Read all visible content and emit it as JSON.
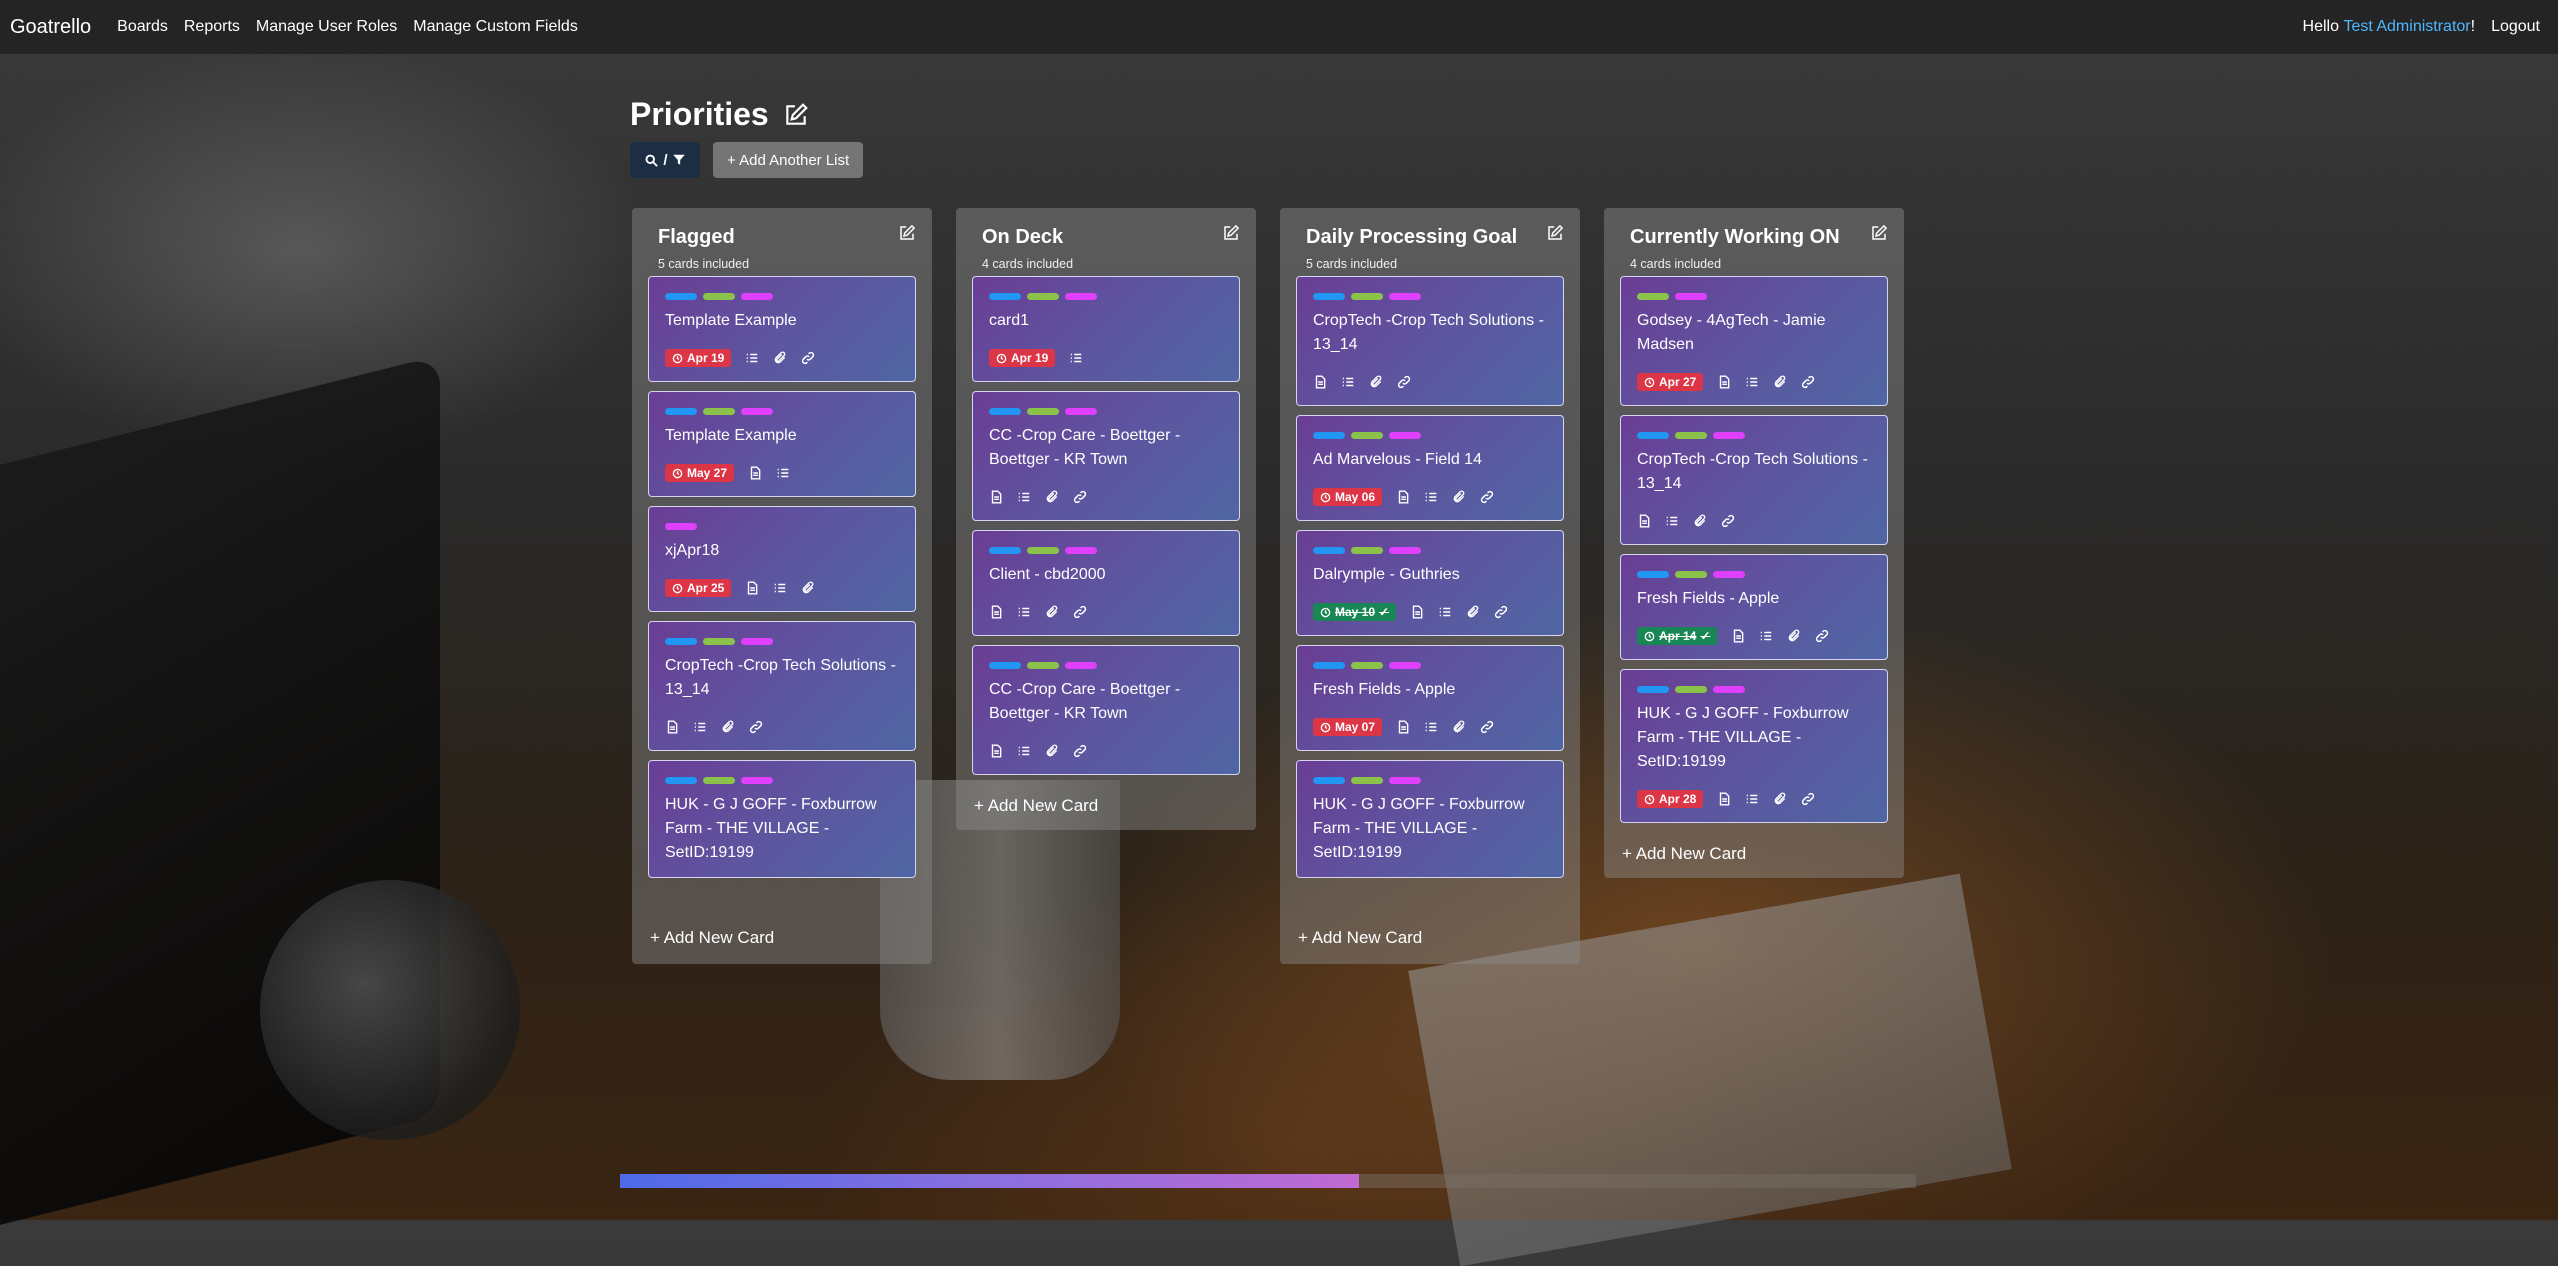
{
  "nav": {
    "brand": "Goatrello",
    "links": [
      "Boards",
      "Reports",
      "Manage User Roles",
      "Manage Custom Fields"
    ],
    "hello": "Hello ",
    "user": "Test Administrator",
    "exclaim": "!",
    "logout": "Logout"
  },
  "board": {
    "title": "Priorities",
    "search_label": "/",
    "add_list": "+ Add Another List",
    "add_card": "+ Add New Card"
  },
  "lists": [
    {
      "title": "Flagged",
      "count": "5 cards included",
      "cards": [
        {
          "labels": [
            "blue",
            "green",
            "magenta"
          ],
          "title": "Template Example",
          "due": "Apr 19",
          "due_status": "overdue",
          "icons": [
            "checklist-icon",
            "attachment-icon",
            "link-icon"
          ]
        },
        {
          "labels": [
            "blue",
            "green",
            "magenta"
          ],
          "title": "Template Example",
          "due": "May 27",
          "due_status": "overdue",
          "icons": [
            "description-icon",
            "checklist-icon"
          ]
        },
        {
          "labels": [
            "magenta"
          ],
          "title": "xjApr18",
          "due": "Apr 25",
          "due_status": "overdue",
          "icons": [
            "description-icon",
            "checklist-icon",
            "attachment-icon"
          ]
        },
        {
          "labels": [
            "blue",
            "green",
            "magenta"
          ],
          "title": "CropTech -Crop Tech Solutions - 13_14",
          "due": "",
          "due_status": "",
          "icons": [
            "description-icon",
            "checklist-icon",
            "attachment-icon",
            "link-icon"
          ]
        },
        {
          "labels": [
            "blue",
            "green",
            "magenta"
          ],
          "title": "HUK - G J GOFF - Foxburrow Farm - THE VILLAGE - SetID:19199",
          "due": "",
          "due_status": "",
          "icons": []
        }
      ]
    },
    {
      "title": "On Deck",
      "count": "4 cards included",
      "cards": [
        {
          "labels": [
            "blue",
            "green",
            "magenta"
          ],
          "title": "card1",
          "due": "Apr 19",
          "due_status": "overdue",
          "icons": [
            "checklist-icon"
          ]
        },
        {
          "labels": [
            "blue",
            "green",
            "magenta"
          ],
          "title": "CC -Crop Care - Boettger - Boettger - KR Town",
          "due": "",
          "due_status": "",
          "icons": [
            "description-icon",
            "checklist-icon",
            "attachment-icon",
            "link-icon"
          ]
        },
        {
          "labels": [
            "blue",
            "green",
            "magenta"
          ],
          "title": "Client - cbd2000",
          "due": "",
          "due_status": "",
          "icons": [
            "description-icon",
            "checklist-icon",
            "attachment-icon",
            "link-icon"
          ]
        },
        {
          "labels": [
            "blue",
            "green",
            "magenta"
          ],
          "title": "CC -Crop Care - Boettger - Boettger - KR Town",
          "due": "",
          "due_status": "",
          "icons": [
            "description-icon",
            "checklist-icon",
            "attachment-icon",
            "link-icon"
          ]
        }
      ]
    },
    {
      "title": "Daily Processing Goal",
      "count": "5 cards included",
      "cards": [
        {
          "labels": [
            "blue",
            "green",
            "magenta"
          ],
          "title": "CropTech -Crop Tech Solutions - 13_14",
          "due": "",
          "due_status": "",
          "icons": [
            "description-icon",
            "checklist-icon",
            "attachment-icon",
            "link-icon"
          ]
        },
        {
          "labels": [
            "blue",
            "green",
            "magenta"
          ],
          "title": "Ad Marvelous - Field 14",
          "due": "May 06",
          "due_status": "overdue",
          "icons": [
            "description-icon",
            "checklist-icon",
            "attachment-icon",
            "link-icon"
          ]
        },
        {
          "labels": [
            "blue",
            "green",
            "magenta"
          ],
          "title": "Dalrymple - Guthries",
          "due": "May 10",
          "due_status": "complete",
          "icons": [
            "description-icon",
            "checklist-icon",
            "attachment-icon",
            "link-icon"
          ]
        },
        {
          "labels": [
            "blue",
            "green",
            "magenta"
          ],
          "title": "Fresh Fields - Apple",
          "due": "May 07",
          "due_status": "overdue",
          "icons": [
            "description-icon",
            "checklist-icon",
            "attachment-icon",
            "link-icon"
          ]
        },
        {
          "labels": [
            "blue",
            "green",
            "magenta"
          ],
          "title": "HUK - G J GOFF - Foxburrow Farm - THE VILLAGE - SetID:19199",
          "due": "",
          "due_status": "",
          "icons": []
        }
      ]
    },
    {
      "title": "Currently Working ON",
      "count": "4 cards included",
      "cards": [
        {
          "labels": [
            "green",
            "magenta"
          ],
          "title": "Godsey - 4AgTech - Jamie Madsen",
          "due": "Apr 27",
          "due_status": "overdue",
          "icons": [
            "description-icon",
            "checklist-icon",
            "attachment-icon",
            "link-icon"
          ]
        },
        {
          "labels": [
            "blue",
            "green",
            "magenta"
          ],
          "title": "CropTech -Crop Tech Solutions - 13_14",
          "due": "",
          "due_status": "",
          "icons": [
            "description-icon",
            "checklist-icon",
            "attachment-icon",
            "link-icon"
          ]
        },
        {
          "labels": [
            "blue",
            "green",
            "magenta"
          ],
          "title": "Fresh Fields - Apple",
          "due": "Apr 14",
          "due_status": "complete",
          "icons": [
            "description-icon",
            "checklist-icon",
            "attachment-icon",
            "link-icon"
          ]
        },
        {
          "labels": [
            "blue",
            "green",
            "magenta"
          ],
          "title": "HUK - G J GOFF - Foxburrow Farm - THE VILLAGE - SetID:19199",
          "due": "Apr 28",
          "due_status": "overdue",
          "icons": [
            "description-icon",
            "checklist-icon",
            "attachment-icon",
            "link-icon"
          ]
        }
      ]
    }
  ],
  "colors": {
    "overdue": "#dc3545",
    "complete": "#198754",
    "accent_user": "#4db8ff"
  },
  "scroll": {
    "position_fraction": 0.57
  }
}
